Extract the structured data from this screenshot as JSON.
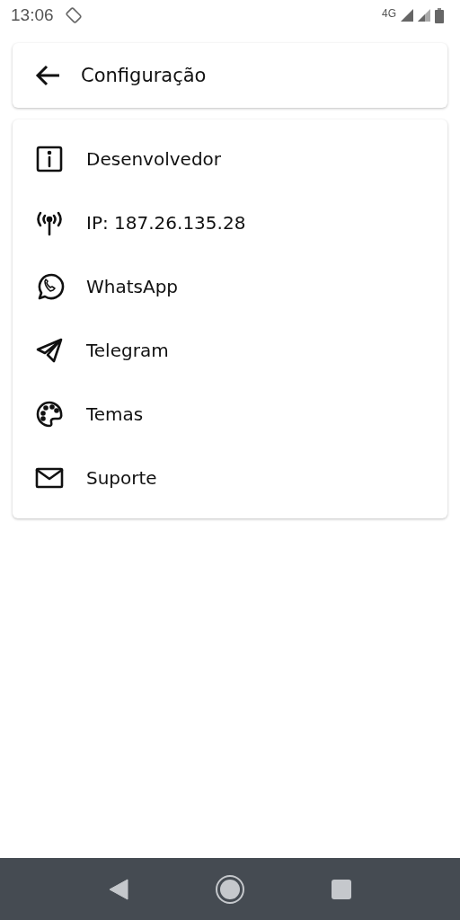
{
  "status_bar": {
    "time": "13:06",
    "network": "4G"
  },
  "header": {
    "title": "Configuração"
  },
  "menu": [
    {
      "kind": "info",
      "label": "Desenvolvedor"
    },
    {
      "kind": "antenna",
      "label": "IP: 187.26.135.28"
    },
    {
      "kind": "whatsapp",
      "label": "WhatsApp"
    },
    {
      "kind": "telegram",
      "label": "Telegram"
    },
    {
      "kind": "palette",
      "label": "Temas"
    },
    {
      "kind": "mail",
      "label": "Suporte"
    }
  ]
}
